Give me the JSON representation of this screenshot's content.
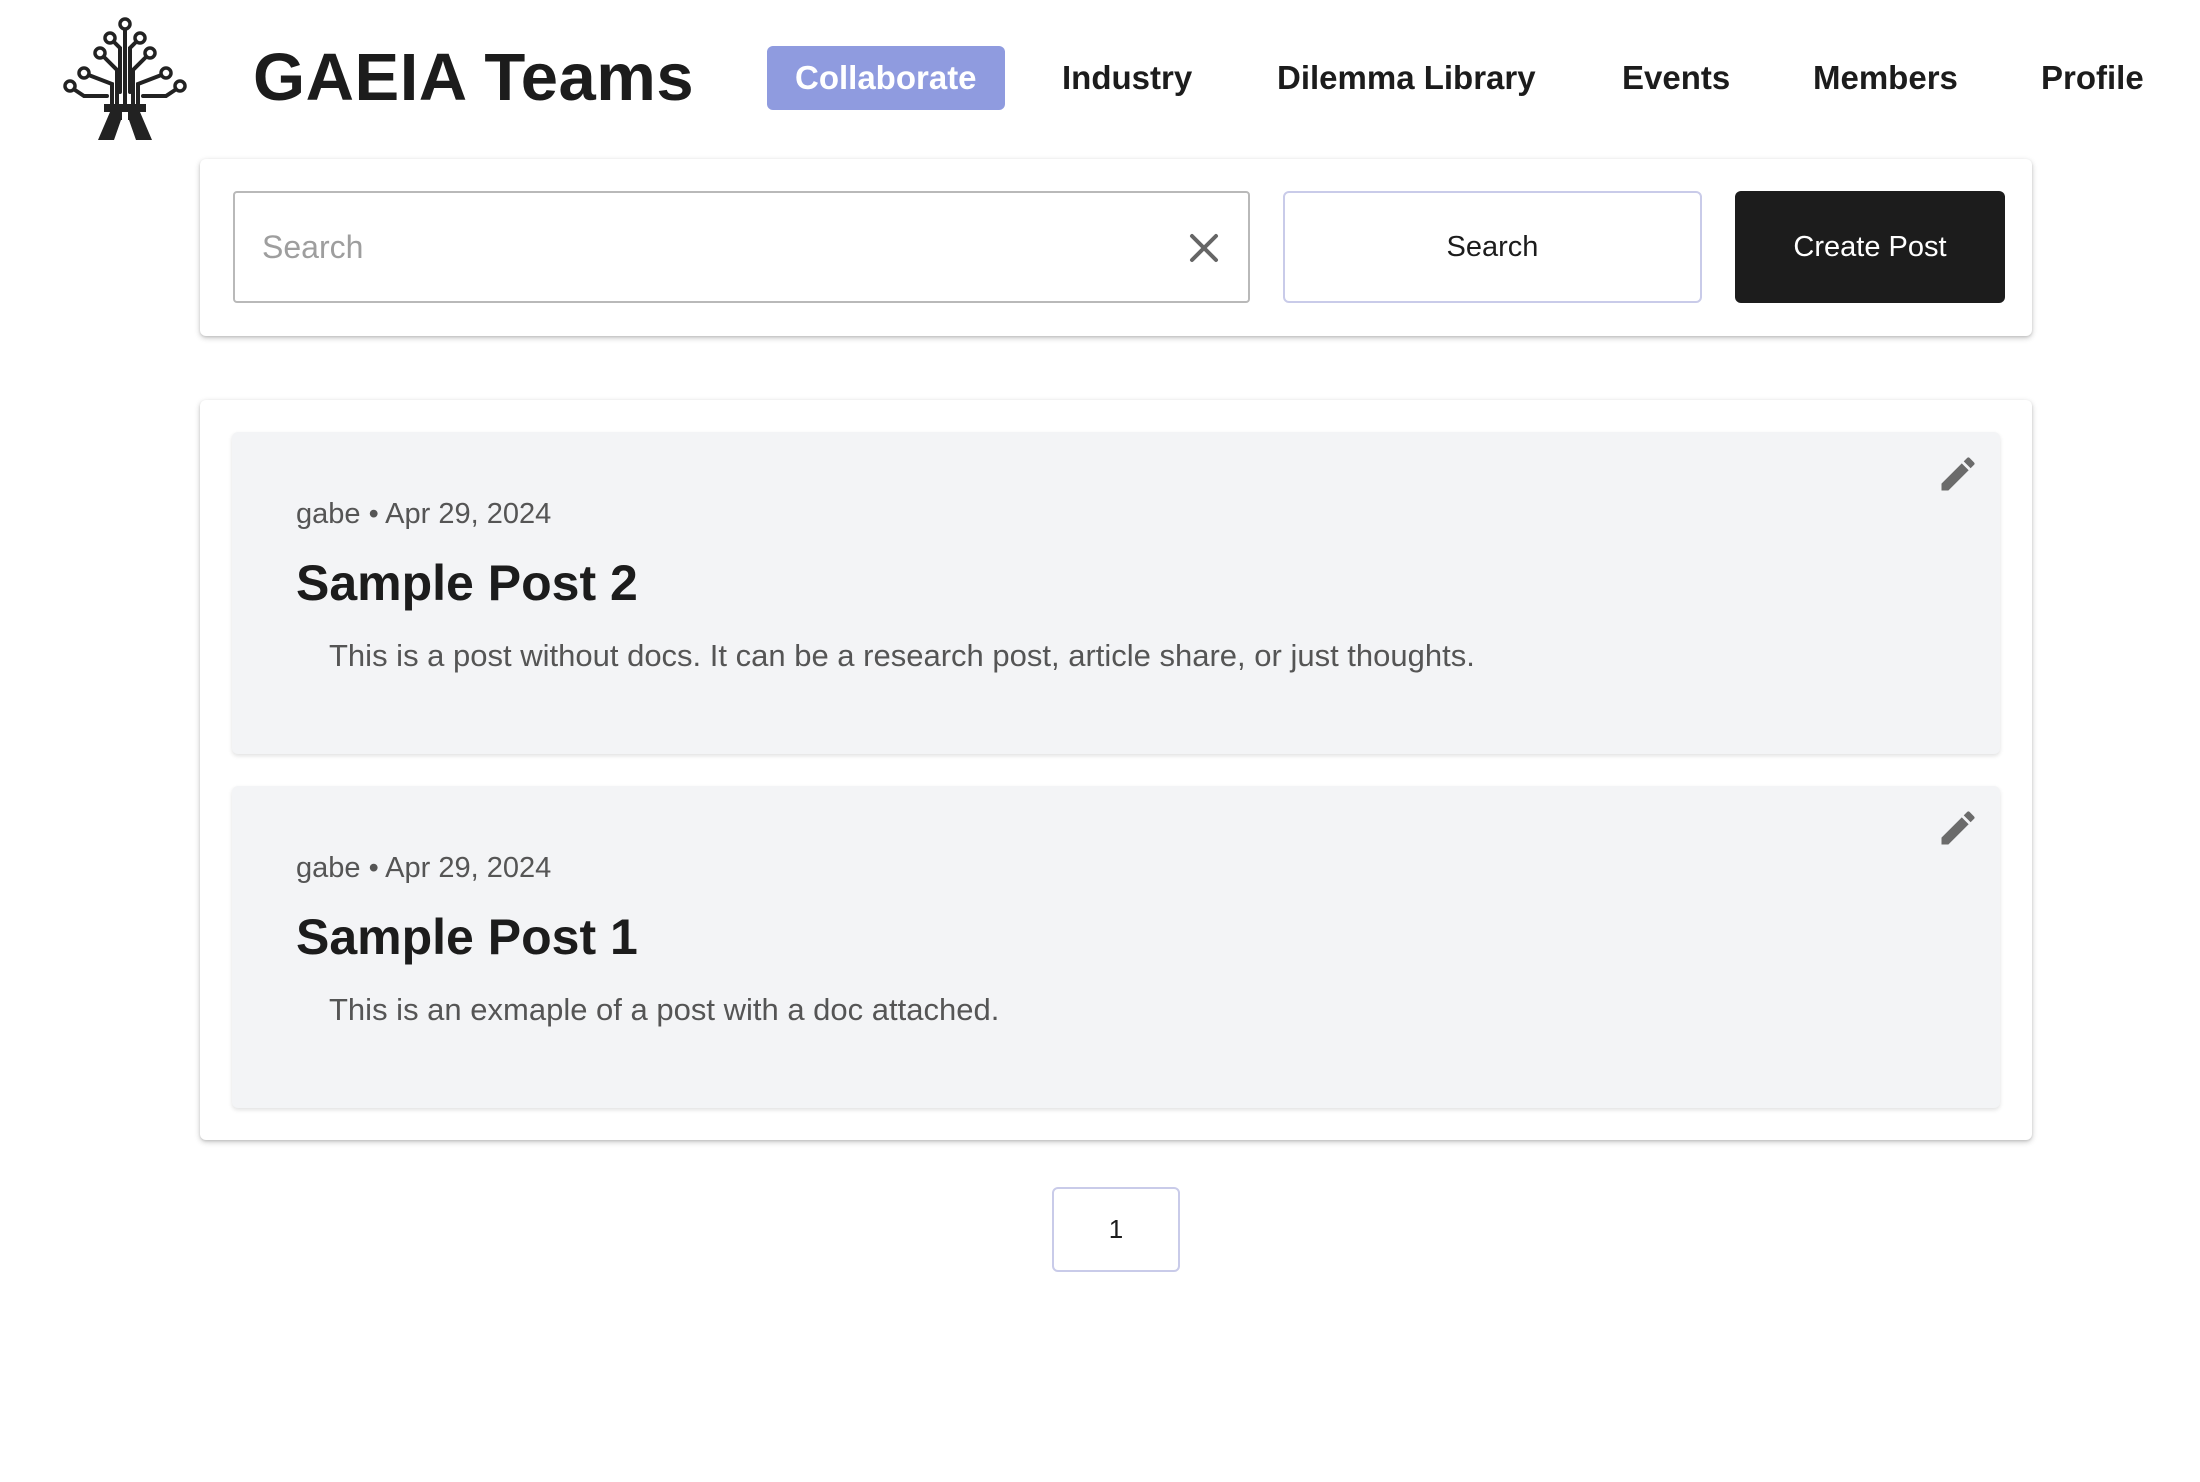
{
  "header": {
    "brand": "GAEIA Teams",
    "nav": [
      {
        "label": "Collaborate",
        "active": true
      },
      {
        "label": "Industry"
      },
      {
        "label": "Dilemma Library"
      },
      {
        "label": "Events"
      },
      {
        "label": "Members"
      },
      {
        "label": "Profile"
      }
    ]
  },
  "search": {
    "placeholder": "Search",
    "value": "",
    "search_label": "Search",
    "create_label": "Create Post"
  },
  "posts": [
    {
      "meta": "gabe • Apr 29, 2024",
      "title": "Sample Post 2",
      "body": "This is a post without docs. It can be a research post, article share, or just thoughts."
    },
    {
      "meta": "gabe • Apr 29, 2024",
      "title": "Sample Post 1",
      "body": "This is an exmaple of a post with a doc attached."
    }
  ],
  "pagination": {
    "current_page": "1"
  },
  "colors": {
    "accent": "#8f9bdf",
    "primary_button": "#1c1c1c",
    "post_bg": "#f3f4f6"
  },
  "icons": {
    "logo": "circuit-tree-logo",
    "clear": "close-icon",
    "edit": "pencil-icon"
  }
}
